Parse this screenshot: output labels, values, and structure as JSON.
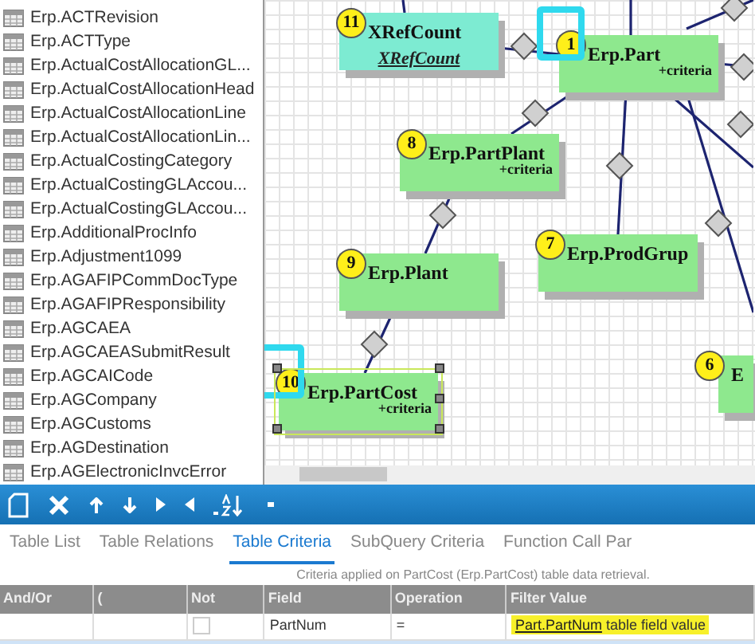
{
  "table_list": [
    {
      "label": "Erp.ACTRevision"
    },
    {
      "label": "Erp.ACTType"
    },
    {
      "label": "Erp.ActualCostAllocationGL..."
    },
    {
      "label": "Erp.ActualCostAllocationHead"
    },
    {
      "label": "Erp.ActualCostAllocationLine"
    },
    {
      "label": "Erp.ActualCostAllocationLin..."
    },
    {
      "label": "Erp.ActualCostingCategory"
    },
    {
      "label": "Erp.ActualCostingGLAccou..."
    },
    {
      "label": "Erp.ActualCostingGLAccou..."
    },
    {
      "label": "Erp.AdditionalProcInfo"
    },
    {
      "label": "Erp.Adjustment1099"
    },
    {
      "label": "Erp.AGAFIPCommDocType"
    },
    {
      "label": "Erp.AGAFIPResponsibility"
    },
    {
      "label": "Erp.AGCAEA"
    },
    {
      "label": "Erp.AGCAEASubmitResult"
    },
    {
      "label": "Erp.AGCAICode"
    },
    {
      "label": "Erp.AGCompany"
    },
    {
      "label": "Erp.AGCustoms"
    },
    {
      "label": "Erp.AGDestination"
    },
    {
      "label": "Erp.AGElectronicInvcError"
    }
  ],
  "diagram": {
    "nodes": [
      {
        "number": "11",
        "title": "XRefCount",
        "subtitle": "XRefCount",
        "kind": "calc",
        "highlighted": false,
        "selected": false
      },
      {
        "number": "1",
        "title": "Erp.Part",
        "criteria": "+criteria",
        "kind": "table",
        "highlighted": true,
        "selected": false
      },
      {
        "number": "8",
        "title": "Erp.PartPlant",
        "criteria": "+criteria",
        "kind": "table",
        "highlighted": false,
        "selected": false
      },
      {
        "number": "9",
        "title": "Erp.Plant",
        "kind": "table",
        "highlighted": false,
        "selected": false
      },
      {
        "number": "7",
        "title": "Erp.ProdGrup",
        "kind": "table",
        "highlighted": false,
        "selected": false
      },
      {
        "number": "10",
        "title": "Erp.PartCost",
        "criteria": "+criteria",
        "kind": "table",
        "highlighted": true,
        "selected": true
      },
      {
        "number": "6",
        "title": "E",
        "kind": "table",
        "highlighted": false,
        "selected": false
      }
    ]
  },
  "tabs": [
    {
      "label": "Table List",
      "selected": false
    },
    {
      "label": "Table Relations",
      "selected": false
    },
    {
      "label": "Table Criteria",
      "selected": true
    },
    {
      "label": "SubQuery Criteria",
      "selected": false
    },
    {
      "label": "Function Call Par",
      "selected": false
    }
  ],
  "criteria_caption": "Criteria applied on PartCost (Erp.PartCost)  table data retrieval.",
  "criteria_table": {
    "columns": [
      "And/Or",
      "(",
      "Not",
      "Field",
      "Operation",
      "Filter Value"
    ],
    "rows": [
      {
        "and_or": "",
        "paren": "",
        "not": false,
        "field": "PartNum",
        "operation": "=",
        "filter_link": "Part.PartNum",
        "filter_text": "table field value",
        "highlighted": true
      }
    ]
  }
}
